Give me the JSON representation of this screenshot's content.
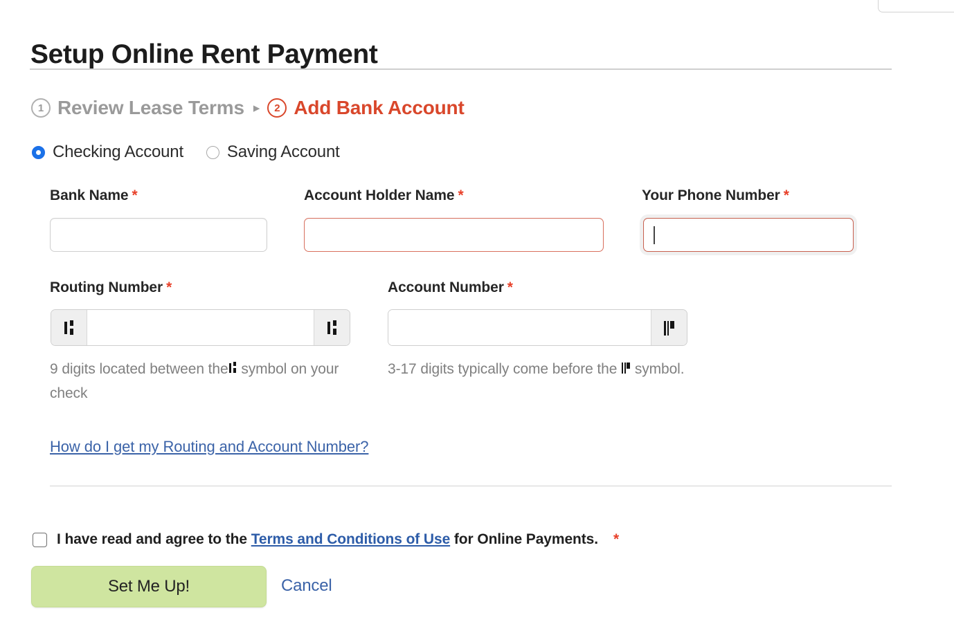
{
  "page": {
    "title": "Setup Online Rent Payment"
  },
  "steps": {
    "separator": "▸",
    "items": [
      {
        "number": "1",
        "label": "Review Lease Terms",
        "state": "done"
      },
      {
        "number": "2",
        "label": "Add Bank Account",
        "state": "active"
      }
    ]
  },
  "account_type": {
    "options": [
      {
        "label": "Checking Account",
        "selected": true
      },
      {
        "label": "Saving Account",
        "selected": false
      }
    ]
  },
  "fields": {
    "bank_name": {
      "label": "Bank Name",
      "required_marker": "*",
      "value": "",
      "state": "normal"
    },
    "account_holder_name": {
      "label": "Account Holder Name",
      "required_marker": "*",
      "value": "",
      "state": "invalid"
    },
    "phone_number": {
      "label": "Your Phone Number",
      "required_marker": "*",
      "value": "",
      "state": "focused-invalid"
    },
    "routing_number": {
      "label": "Routing Number",
      "required_marker": "*",
      "value": "",
      "addon_left_icon": "micr-transit-symbol",
      "addon_right_icon": "micr-transit-symbol",
      "helper_prefix": "9 digits located between the",
      "helper_icon": "micr-transit-symbol",
      "helper_suffix": "symbol on your check"
    },
    "account_number": {
      "label": "Account Number",
      "required_marker": "*",
      "value": "",
      "addon_right_icon": "micr-onus-symbol",
      "helper_prefix": "3-17 digits typically come before the",
      "helper_icon": "micr-onus-symbol",
      "helper_suffix": "symbol."
    }
  },
  "help_link": {
    "label": "How do I get my Routing and Account Number?"
  },
  "agreement": {
    "checked": false,
    "text_before": "I have read and agree to the",
    "link_label": "Terms and Conditions of Use",
    "text_after": "for Online Payments.",
    "required_marker": "*"
  },
  "actions": {
    "submit_label": "Set Me Up!",
    "cancel_label": "Cancel"
  },
  "colors": {
    "accent_active_step": "#d9472b",
    "required_star": "#e8412a",
    "link": "#3b63a8",
    "radio_selected": "#1b72e8",
    "primary_button_bg": "#cfe5a0",
    "invalid_border": "#d9705e"
  }
}
